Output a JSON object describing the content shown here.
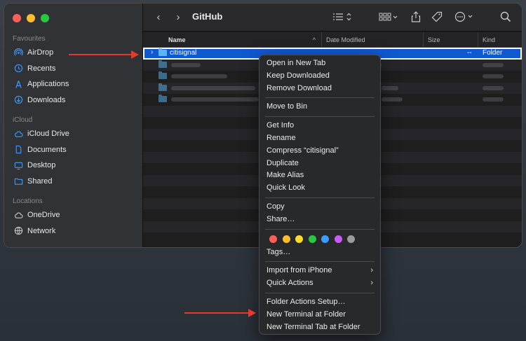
{
  "window": {
    "title": "GitHub"
  },
  "sidebar": {
    "favourites_header": "Favourites",
    "favourites": [
      {
        "label": "AirDrop",
        "icon": "airdrop-icon"
      },
      {
        "label": "Recents",
        "icon": "clock-icon"
      },
      {
        "label": "Applications",
        "icon": "applications-icon"
      },
      {
        "label": "Downloads",
        "icon": "download-icon"
      }
    ],
    "icloud_header": "iCloud",
    "icloud": [
      {
        "label": "iCloud Drive",
        "icon": "cloud-icon"
      },
      {
        "label": "Documents",
        "icon": "document-icon"
      },
      {
        "label": "Desktop",
        "icon": "desktop-icon"
      },
      {
        "label": "Shared",
        "icon": "shared-folder-icon"
      }
    ],
    "locations_header": "Locations",
    "locations": [
      {
        "label": "OneDrive",
        "icon": "cloud-icon"
      },
      {
        "label": "Network",
        "icon": "globe-icon"
      }
    ]
  },
  "columns": {
    "name": "Name",
    "date_modified": "Date Modified",
    "size": "Size",
    "kind": "Kind"
  },
  "files": {
    "selected": {
      "name": "citisignal",
      "size": "--",
      "kind": "Folder"
    }
  },
  "context_menu": {
    "groups": [
      [
        "Open in New Tab",
        "Keep Downloaded",
        "Remove Download"
      ],
      [
        "Move to Bin"
      ],
      [
        "Get Info",
        "Rename",
        "Compress “citisignal”",
        "Duplicate",
        "Make Alias",
        "Quick Look"
      ],
      [
        "Copy",
        "Share…"
      ]
    ],
    "tags_label": "Tags…",
    "tag_colors": [
      "#ff5f57",
      "#febc2e",
      "#fedb2e",
      "#28c840",
      "#3d9bff",
      "#c65df5",
      "#9a9a9e"
    ],
    "import": "Import from iPhone",
    "quick_actions": "Quick Actions",
    "folder_actions": "Folder Actions Setup…",
    "new_terminal": "New Terminal at Folder",
    "new_terminal_tab": "New Terminal Tab at Folder"
  },
  "colors": {
    "selection": "#1058d0",
    "annotation_arrow": "#e8392a"
  }
}
